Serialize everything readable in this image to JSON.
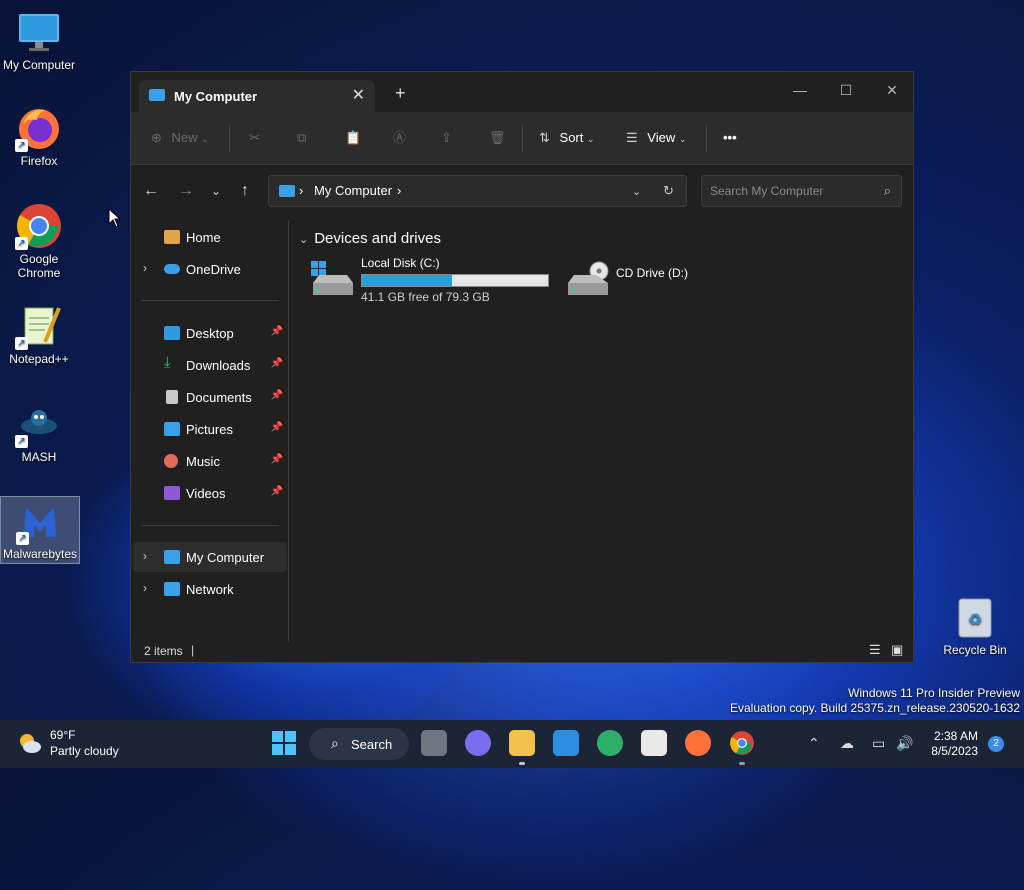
{
  "desktop": {
    "icons": [
      {
        "label": "My Computer"
      },
      {
        "label": "Firefox"
      },
      {
        "label": "Google Chrome"
      },
      {
        "label": "Notepad++"
      },
      {
        "label": "MASH"
      },
      {
        "label": "Malwarebytes"
      }
    ],
    "recycle_bin": "Recycle Bin",
    "watermark": {
      "line1": "Windows 11 Pro Insider Preview",
      "line2": "Evaluation copy. Build 25375.zn_release.230520-1632"
    }
  },
  "window": {
    "tab_title": "My Computer",
    "toolbar": {
      "new_label": "New",
      "sort_label": "Sort",
      "view_label": "View",
      "more_label": "•••"
    },
    "address": {
      "crumb": "My Computer",
      "search_placeholder": "Search My Computer"
    },
    "sidebar": {
      "home": "Home",
      "onedrive": "OneDrive",
      "quick": [
        {
          "label": "Desktop"
        },
        {
          "label": "Downloads"
        },
        {
          "label": "Documents"
        },
        {
          "label": "Pictures"
        },
        {
          "label": "Music"
        },
        {
          "label": "Videos"
        }
      ],
      "mycomputer": "My Computer",
      "network": "Network"
    },
    "content": {
      "group_header": "Devices and drives",
      "drives": [
        {
          "name": "Local Disk (C:)",
          "free_text": "41.1 GB free of 79.3 GB",
          "used_fraction": 0.482
        },
        {
          "name": "CD Drive (D:)"
        }
      ]
    },
    "status": {
      "items": "2 items"
    }
  },
  "taskbar": {
    "weather_temp": "69°F",
    "weather_desc": "Partly cloudy",
    "search_label": "Search",
    "time": "2:38 AM",
    "date": "8/5/2023",
    "notifications": "2"
  },
  "colors": {
    "accent": "#26a0da",
    "window_bg": "#202020",
    "toolbar_bg": "#2c2c2c",
    "taskbar_bg": "#1c2536"
  }
}
